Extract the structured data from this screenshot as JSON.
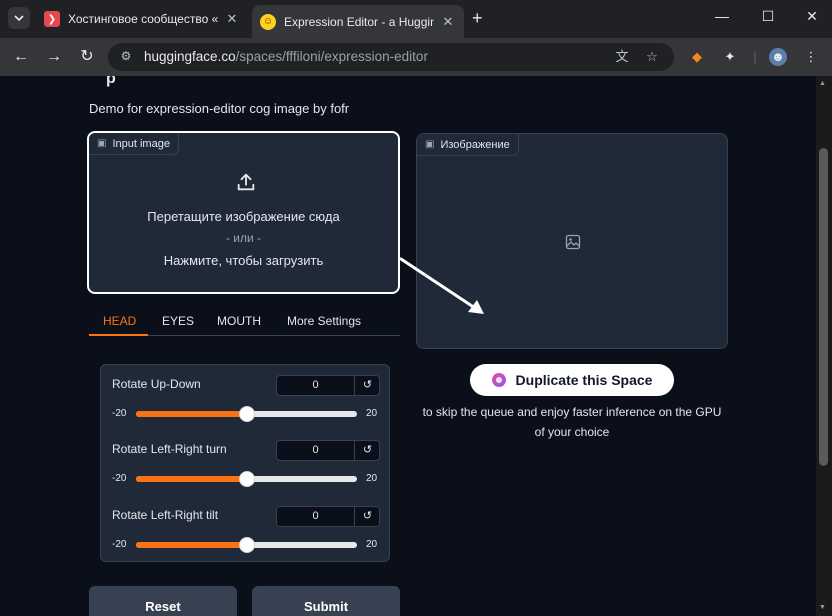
{
  "browser": {
    "tabs": [
      {
        "title": "Хостинговое сообщество «Tim",
        "favicon": "timeweb-icon",
        "color": "#e5484d"
      },
      {
        "title": "Expression Editor - a Hugging F",
        "favicon": "hugging-face-icon",
        "color": "#ffd21e"
      }
    ],
    "new_tab_label": "+",
    "url_host": "huggingface.co",
    "url_path": "/spaces/fffiloni/expression-editor"
  },
  "page": {
    "heading_partial": "p",
    "description": "Demo for expression-editor cog image by fofr",
    "input_image": {
      "label": "Input image",
      "drop_text": "Перетащите изображение сюда",
      "or_text": "- или -",
      "click_text": "Нажмите, чтобы загрузить"
    },
    "output_image": {
      "label": "Изображение"
    },
    "tabs": [
      "HEAD",
      "EYES",
      "MOUTH",
      "More Settings"
    ],
    "selected_tab": "HEAD",
    "sliders": [
      {
        "label": "Rotate Up-Down",
        "value": "0",
        "min": "-20",
        "max": "20",
        "fraction": 0.5
      },
      {
        "label": "Rotate Left-Right turn",
        "value": "0",
        "min": "-20",
        "max": "20",
        "fraction": 0.5
      },
      {
        "label": "Rotate Left-Right tilt",
        "value": "0",
        "min": "-20",
        "max": "20",
        "fraction": 0.5
      }
    ],
    "reset_label": "Reset",
    "submit_label": "Submit",
    "duplicate": {
      "button_label": "Duplicate this Space",
      "note": "to skip the queue and enjoy faster inference on the GPU of your choice"
    }
  },
  "colors": {
    "accent": "#f97316",
    "background": "#0b0f19",
    "panel": "#1f2937"
  }
}
